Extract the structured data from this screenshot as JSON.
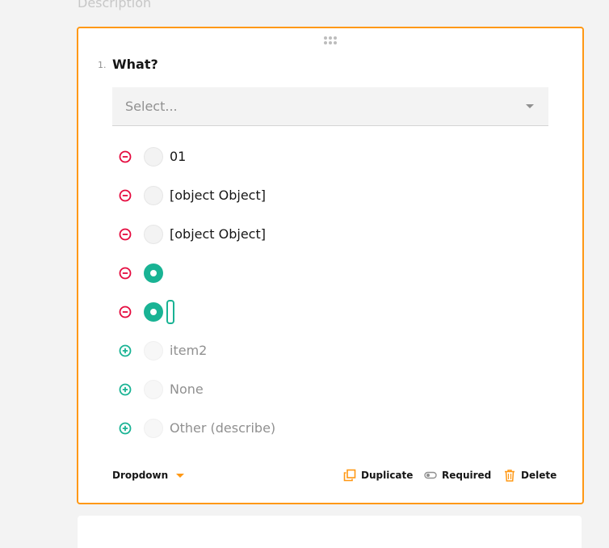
{
  "description_label": "Description",
  "question": {
    "number": "1.",
    "title": "What?",
    "select_placeholder": "Select...",
    "choices": [
      {
        "label": "01",
        "state": "unchecked",
        "action": "remove"
      },
      {
        "label": "[object Object]",
        "state": "unchecked",
        "action": "remove"
      },
      {
        "label": "[object Object]",
        "state": "unchecked",
        "action": "remove"
      },
      {
        "label": "",
        "state": "checked",
        "action": "remove"
      },
      {
        "label": "",
        "state": "checked-editing",
        "action": "remove"
      },
      {
        "label": "item2",
        "state": "placeholder",
        "action": "add"
      },
      {
        "label": "None",
        "state": "placeholder",
        "action": "add"
      },
      {
        "label": "Other (describe)",
        "state": "placeholder",
        "action": "add"
      }
    ]
  },
  "footer": {
    "type_label": "Dropdown",
    "duplicate_label": "Duplicate",
    "required_label": "Required",
    "delete_label": "Delete"
  },
  "icons": {
    "remove": "minus-circle-icon",
    "add": "plus-circle-icon",
    "duplicate": "duplicate-icon",
    "required": "toggle-icon",
    "delete": "trash-icon",
    "drag": "drag-handle-icon"
  },
  "colors": {
    "accent": "#ff9814",
    "primary": "#19b394",
    "danger": "#e50a3e",
    "text": "#161616",
    "muted": "#909090"
  }
}
